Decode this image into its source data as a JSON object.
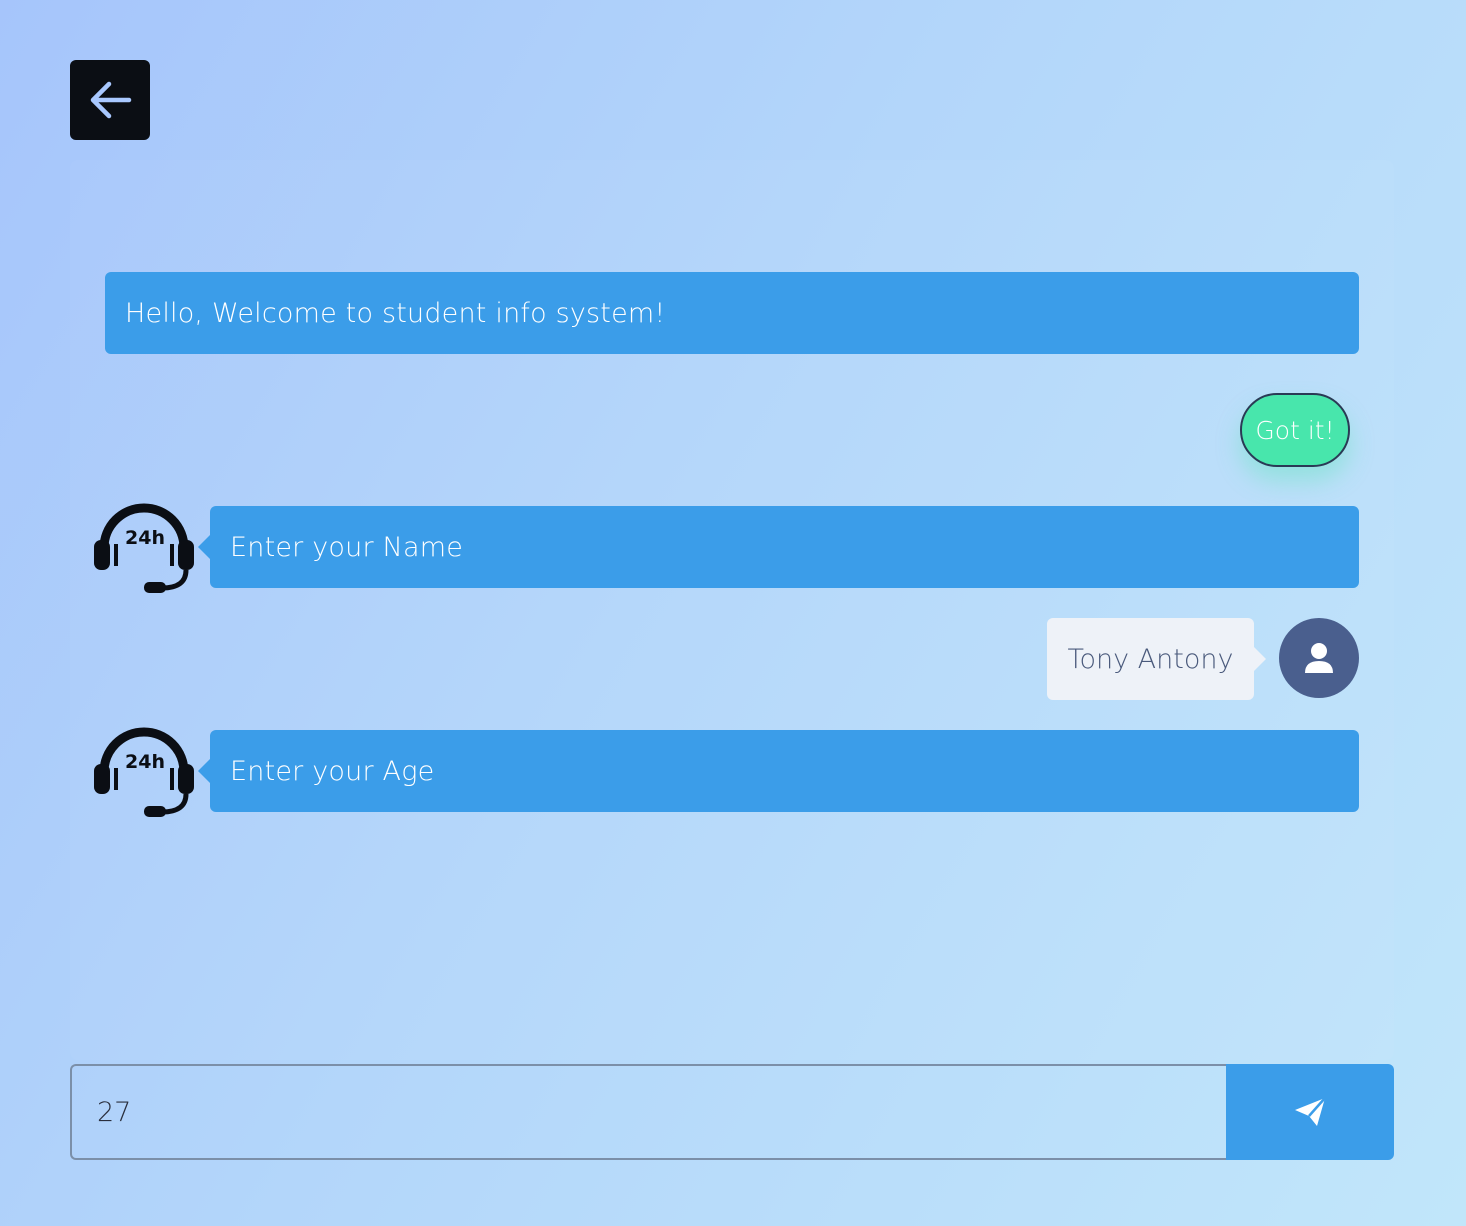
{
  "nav": {
    "back_icon": "arrow-left-icon"
  },
  "chat": {
    "welcome": "Hello, Welcome to student info system!",
    "ack_button": "Got it!",
    "prompt_name": "Enter your Name",
    "user_name_reply": "Tony Antony",
    "prompt_age": "Enter your Age",
    "bot_avatar_icon": "headset-24h-icon",
    "user_avatar_icon": "user-icon"
  },
  "composer": {
    "value": "27",
    "send_icon": "paper-plane-icon"
  },
  "colors": {
    "accent": "#3b9de9",
    "ack": "#48e6ac",
    "user_avatar": "#4a5f8e",
    "back_button": "#0b0e14"
  }
}
